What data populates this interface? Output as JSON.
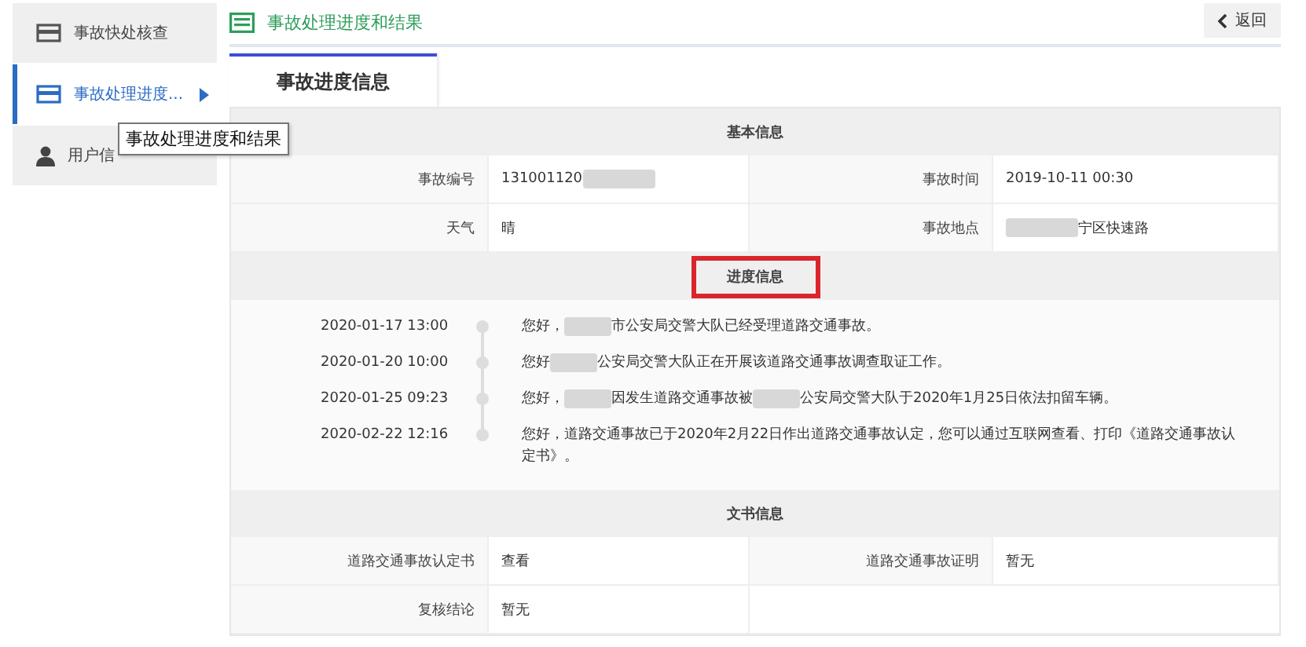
{
  "sidebar": {
    "items": [
      {
        "label": "事故快处核查",
        "kind": "card",
        "selected": false
      },
      {
        "label": "事故处理进度...",
        "kind": "card",
        "selected": true
      },
      {
        "label": "用户信",
        "kind": "user",
        "selected": false
      }
    ],
    "tooltip": "事故处理进度和结果"
  },
  "header": {
    "title": "事故处理进度和结果",
    "back_button": "返回"
  },
  "tabs": [
    {
      "label": "事故进度信息",
      "selected": true
    }
  ],
  "sections": [
    {
      "kind": "fields",
      "title": "基本信息",
      "highlighted": false,
      "rows": [
        [
          {
            "label": "事故编号",
            "segments": [
              {
                "kind": "text",
                "text": "131001120"
              },
              {
                "kind": "redacted"
              }
            ]
          },
          {
            "label": "事故时间",
            "segments": [
              {
                "kind": "text",
                "text": "2019-10-11 00:30"
              }
            ]
          }
        ],
        [
          {
            "label": "天气",
            "segments": [
              {
                "kind": "text",
                "text": "晴"
              }
            ]
          },
          {
            "label": "事故地点",
            "segments": [
              {
                "kind": "redacted"
              },
              {
                "kind": "text",
                "text": "宁区快速路"
              }
            ]
          }
        ]
      ]
    },
    {
      "kind": "timeline",
      "title": "进度信息",
      "highlighted": true,
      "entries": [
        {
          "time": "2020-01-17 13:00",
          "segments": [
            {
              "kind": "text",
              "text": "您好，"
            },
            {
              "kind": "redacted"
            },
            {
              "kind": "text",
              "text": "市公安局交警大队已经受理道路交通事故。"
            }
          ]
        },
        {
          "time": "2020-01-20 10:00",
          "segments": [
            {
              "kind": "text",
              "text": "您好"
            },
            {
              "kind": "redacted"
            },
            {
              "kind": "text",
              "text": "公安局交警大队正在开展该道路交通事故调查取证工作。"
            }
          ]
        },
        {
          "time": "2020-01-25 09:23",
          "segments": [
            {
              "kind": "text",
              "text": "您好，"
            },
            {
              "kind": "redacted"
            },
            {
              "kind": "text",
              "text": "因发生道路交通事故被"
            },
            {
              "kind": "redacted"
            },
            {
              "kind": "text",
              "text": "公安局交警大队于2020年1月25日依法扣留车辆。"
            }
          ]
        },
        {
          "time": "2020-02-22 12:16",
          "segments": [
            {
              "kind": "text",
              "text": "您好，道路交通事故已于2020年2月22日作出道路交通事故认定，您可以通过互联网查看、打印《道路交通事故认定书》。"
            }
          ]
        }
      ]
    },
    {
      "kind": "fields",
      "title": "文书信息",
      "highlighted": false,
      "rows": [
        [
          {
            "label": "道路交通事故认定书",
            "segments": [
              {
                "kind": "text",
                "text": "查看"
              }
            ]
          },
          {
            "label": "道路交通事故证明",
            "segments": [
              {
                "kind": "text",
                "text": "暂无"
              }
            ]
          }
        ],
        [
          {
            "label": "复核结论",
            "segments": [
              {
                "kind": "text",
                "text": "暂无"
              }
            ]
          }
        ]
      ]
    }
  ]
}
